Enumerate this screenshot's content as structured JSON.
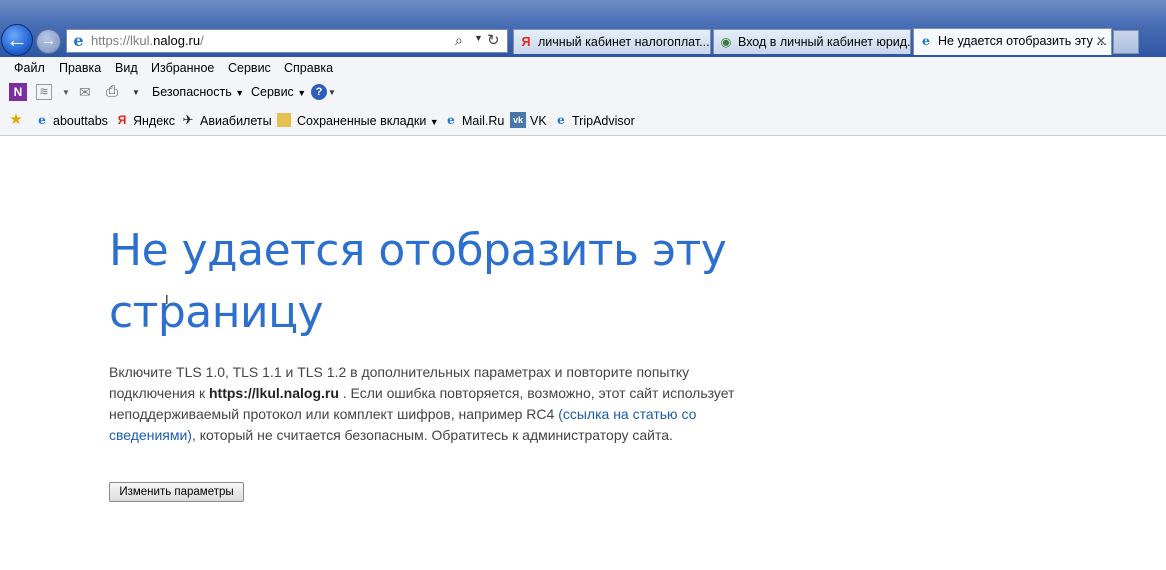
{
  "address_bar": {
    "url_prefix": "https://lkul.",
    "url_host": "nalog.ru",
    "url_suffix": "/"
  },
  "tabs": [
    {
      "label": "личный кабинет налогоплат...",
      "icon": "yandex-icon",
      "active": false
    },
    {
      "label": "Вход в личный кабинет юрид...",
      "icon": "chrome-icon",
      "active": false
    },
    {
      "label": "Не удается отобразить эту ...",
      "icon": "ie-icon",
      "active": true
    }
  ],
  "menu": [
    "Файл",
    "Правка",
    "Вид",
    "Избранное",
    "Сервис",
    "Справка"
  ],
  "command_bar": {
    "security": "Безопасность",
    "service": "Сервис"
  },
  "favorites": [
    "abouttabs",
    "Яндекс",
    "Авиабилеты",
    "Сохраненные вкладки",
    "Mail.Ru",
    "VK",
    "TripAdvisor"
  ],
  "page": {
    "title": "Не удается отобразить эту страницу",
    "body_part1": "Включите TLS 1.0, TLS 1.1 и TLS 1.2 в дополнительных параметрах и повторите попытку подключения к ",
    "body_url": "https://lkul.nalog.ru",
    "body_part2": " . Если ошибка повторяется, возможно, этот сайт использует неподдерживаемый протокол или комплект шифров, например RC4 ",
    "link_text": "(ссылка на статью со сведениями)",
    "body_part3": ", который не считается безопасным. Обратитесь к администратору сайта.",
    "button_label": "Изменить параметры"
  },
  "colors": {
    "title_blue": "#2c6fcf",
    "link_blue": "#1a5bb4",
    "frame_blue": "#2d55a4"
  }
}
